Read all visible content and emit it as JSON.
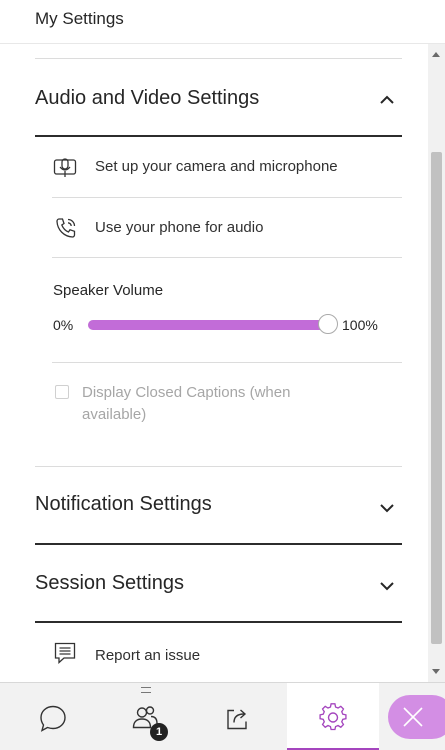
{
  "header": {
    "title": "My Settings"
  },
  "audio_video": {
    "title": "Audio and Video Settings",
    "expanded": true,
    "camera_label": "Set up your camera and microphone",
    "phone_label": "Use your phone for audio",
    "speaker_volume": {
      "label": "Speaker Volume",
      "min_label": "0%",
      "max_label": "100%",
      "value_percent": 100
    },
    "closed_captions": {
      "label": "Display Closed Captions (when available)",
      "checked": false,
      "enabled": false
    }
  },
  "notification": {
    "title": "Notification Settings",
    "expanded": false
  },
  "session": {
    "title": "Session Settings",
    "expanded": false
  },
  "report": {
    "label": "Report an issue"
  },
  "bottom_bar": {
    "tabs": [
      {
        "icon": "chat-bubble-icon"
      },
      {
        "icon": "participants-icon",
        "badge": "1"
      },
      {
        "icon": "share-content-icon"
      },
      {
        "icon": "gear-icon",
        "active": true
      }
    ],
    "close_icon": "close-icon"
  },
  "colors": {
    "accent": "#c26cd8",
    "active_tab_border": "#a445be",
    "close_button": "#d38ee4",
    "divider_strong": "#2c2c2c"
  }
}
